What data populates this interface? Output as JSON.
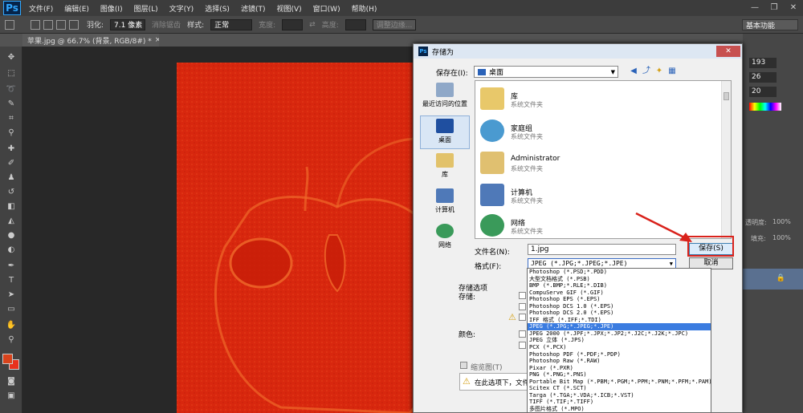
{
  "app": {
    "logo": "Ps",
    "menus": [
      "文件(F)",
      "编辑(E)",
      "图像(I)",
      "图层(L)",
      "文字(Y)",
      "选择(S)",
      "滤镜(T)",
      "视图(V)",
      "窗口(W)",
      "帮助(H)"
    ],
    "window_controls": [
      "—",
      "❐",
      "✕"
    ]
  },
  "options": {
    "feather_label": "羽化:",
    "feather_value": "7.1 像素",
    "antialias": "消除锯齿",
    "style_label": "样式:",
    "style_value": "正常",
    "width_label": "宽度:",
    "height_label": "高度:",
    "refine_edge": "调整边缘...",
    "preset": "基本功能"
  },
  "document": {
    "tab": "苹果.jpg @ 66.7% (背景, RGB/8#) *",
    "tab_close": "×"
  },
  "panel": {
    "values": [
      "193",
      "26",
      "20"
    ],
    "opacity_label": "透明度:",
    "opacity_value": "100%",
    "fill_label": "填充:",
    "fill_value": "100%"
  },
  "dialog": {
    "title": "存储为",
    "save_in_label": "保存在(I):",
    "save_in_value": "桌面",
    "places": [
      {
        "label": "最近访问的位置"
      },
      {
        "label": "桌面"
      },
      {
        "label": "库"
      },
      {
        "label": "计算机"
      },
      {
        "label": "网络"
      }
    ],
    "files": [
      {
        "name": "库",
        "desc": "系统文件夹"
      },
      {
        "name": "家庭组",
        "desc": "系统文件夹"
      },
      {
        "name": "Administrator",
        "desc": "系统文件夹"
      },
      {
        "name": "计算机",
        "desc": "系统文件夹"
      },
      {
        "name": "网络",
        "desc": "系统文件夹"
      }
    ],
    "filename_label": "文件名(N):",
    "filename_value": "1.jpg",
    "format_label": "格式(F):",
    "format_value": "JPEG (*.JPG;*.JPEG;*.JPE)",
    "save_button": "保存(S)",
    "cancel_button": "取消",
    "save_options_label": "存储选项",
    "save_label": "存储:",
    "color_label": "颜色:",
    "thumbnail_label": "缩览图(T)",
    "warning_text": "在此选项下，文件",
    "format_options": [
      "Photoshop (*.PSD;*.PDD)",
      "大型文档格式 (*.PSB)",
      "BMP (*.BMP;*.RLE;*.DIB)",
      "CompuServe GIF (*.GIF)",
      "Photoshop EPS (*.EPS)",
      "Photoshop DCS 1.0 (*.EPS)",
      "Photoshop DCS 2.0 (*.EPS)",
      "IFF 格式 (*.IFF;*.TDI)",
      "JPEG (*.JPG;*.JPEG;*.JPE)",
      "JPEG 2000 (*.JPF;*.JPX;*.JP2;*.J2C;*.J2K;*.JPC)",
      "JPEG 立体 (*.JPS)",
      "PCX (*.PCX)",
      "Photoshop PDF (*.PDF;*.PDP)",
      "Photoshop Raw (*.RAW)",
      "Pixar (*.PXR)",
      "PNG (*.PNG;*.PNS)",
      "Portable Bit Map (*.PBM;*.PGM;*.PPM;*.PNM;*.PFM;*.PAM)",
      "Scitex CT (*.SCT)",
      "Targa (*.TGA;*.VDA;*.ICB;*.VST)",
      "TIFF (*.TIF;*.TIFF)",
      "多图片格式 (*.MPO)"
    ],
    "selected_format_index": 8
  },
  "colors": {
    "canvas": "#d8270e",
    "foreground": "#d8431c",
    "accent": "#d9221b",
    "selection": "#3b7ce0"
  }
}
